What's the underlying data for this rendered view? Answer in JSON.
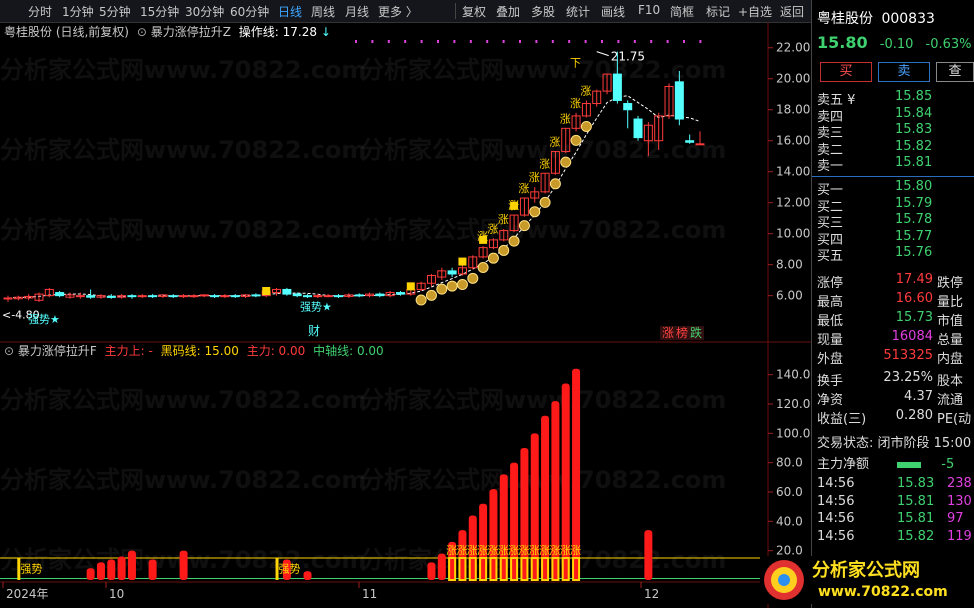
{
  "toolbar": {
    "periods": [
      "分时",
      "1分钟",
      "5分钟",
      "15分钟",
      "30分钟",
      "60分钟",
      "日线",
      "周线",
      "月线",
      "更多 〉"
    ],
    "active": "日线",
    "right": [
      "复权",
      "叠加",
      "多股",
      "统计",
      "画线",
      "F10",
      "简框",
      "标记",
      "+自选",
      "返回"
    ]
  },
  "info_bar": {
    "stock": "粤桂股份 (日线,前复权)",
    "indicator": "暴力涨停拉升Z",
    "line_label": "操作线: 17.28",
    "arrow": "↓"
  },
  "chart_data": {
    "type": "candlestick",
    "price_axis": [
      "22.00",
      "20.00",
      "18.00",
      "16.00",
      "14.00",
      "12.00",
      "10.00",
      "8.00",
      "6.00"
    ],
    "ylim": [
      4.3,
      22.5
    ],
    "annotations": {
      "high": "21.75",
      "low": "4.80",
      "strong": "强势★",
      "cai": "财",
      "zhangting": "涨",
      "bang": "榜",
      "die": "跌",
      "zhang": "涨",
      "xia": "下"
    },
    "candles": [
      {
        "o": 5.8,
        "c": 5.85,
        "h": 6.0,
        "l": 5.6
      },
      {
        "o": 5.8,
        "c": 5.9,
        "h": 6.0,
        "l": 5.7
      },
      {
        "o": 5.85,
        "c": 5.95,
        "h": 6.1,
        "l": 5.7
      },
      {
        "o": 5.7,
        "c": 6.1,
        "h": 6.2,
        "l": 5.6
      },
      {
        "o": 6.0,
        "c": 6.4,
        "h": 6.5,
        "l": 5.9
      },
      {
        "o": 6.2,
        "c": 6.0,
        "h": 6.3,
        "l": 5.9
      },
      {
        "o": 5.9,
        "c": 6.05,
        "h": 6.2,
        "l": 5.8
      },
      {
        "o": 5.95,
        "c": 6.0,
        "h": 6.2,
        "l": 5.8
      },
      {
        "o": 6.0,
        "c": 5.9,
        "h": 6.4,
        "l": 5.8
      },
      {
        "o": 5.9,
        "c": 6.0,
        "h": 6.1,
        "l": 5.8
      },
      {
        "o": 5.95,
        "c": 5.9,
        "h": 6.1,
        "l": 5.8
      },
      {
        "o": 5.9,
        "c": 6.0,
        "h": 6.1,
        "l": 5.8
      },
      {
        "o": 6.0,
        "c": 5.95,
        "h": 6.1,
        "l": 5.8
      },
      {
        "o": 5.95,
        "c": 6.0,
        "h": 6.1,
        "l": 5.85
      },
      {
        "o": 6.0,
        "c": 5.95,
        "h": 6.1,
        "l": 5.85
      },
      {
        "o": 5.95,
        "c": 6.05,
        "h": 6.1,
        "l": 5.85
      },
      {
        "o": 6.0,
        "c": 5.95,
        "h": 6.1,
        "l": 5.85
      },
      {
        "o": 5.95,
        "c": 6.0,
        "h": 6.1,
        "l": 5.85
      },
      {
        "o": 6.0,
        "c": 6.0,
        "h": 6.1,
        "l": 5.85
      },
      {
        "o": 6.0,
        "c": 6.05,
        "h": 6.1,
        "l": 5.9
      },
      {
        "o": 6.0,
        "c": 5.95,
        "h": 6.1,
        "l": 5.85
      },
      {
        "o": 5.95,
        "c": 6.0,
        "h": 6.1,
        "l": 5.85
      },
      {
        "o": 6.0,
        "c": 5.95,
        "h": 6.1,
        "l": 5.85
      },
      {
        "o": 5.95,
        "c": 6.05,
        "h": 6.1,
        "l": 5.85
      },
      {
        "o": 6.05,
        "c": 6.0,
        "h": 6.15,
        "l": 5.9
      },
      {
        "o": 6.0,
        "c": 6.3,
        "h": 6.4,
        "l": 5.9
      },
      {
        "o": 6.2,
        "c": 6.4,
        "h": 6.5,
        "l": 6.0
      },
      {
        "o": 6.4,
        "c": 6.1,
        "h": 6.5,
        "l": 6.0
      },
      {
        "o": 6.1,
        "c": 6.0,
        "h": 6.2,
        "l": 5.9
      },
      {
        "o": 6.0,
        "c": 5.95,
        "h": 6.1,
        "l": 5.85
      },
      {
        "o": 5.95,
        "c": 6.0,
        "h": 6.1,
        "l": 5.85
      },
      {
        "o": 6.0,
        "c": 6.0,
        "h": 6.1,
        "l": 5.9
      },
      {
        "o": 6.0,
        "c": 5.95,
        "h": 6.1,
        "l": 5.85
      },
      {
        "o": 5.95,
        "c": 6.05,
        "h": 6.15,
        "l": 5.85
      },
      {
        "o": 6.05,
        "c": 6.0,
        "h": 6.15,
        "l": 5.9
      },
      {
        "o": 6.0,
        "c": 6.1,
        "h": 6.2,
        "l": 5.9
      },
      {
        "o": 6.1,
        "c": 6.0,
        "h": 6.2,
        "l": 5.9
      },
      {
        "o": 6.0,
        "c": 6.2,
        "h": 6.3,
        "l": 5.9
      },
      {
        "o": 6.2,
        "c": 6.1,
        "h": 6.3,
        "l": 6.0
      },
      {
        "o": 6.1,
        "c": 6.4,
        "h": 6.5,
        "l": 6.0
      },
      {
        "o": 6.4,
        "c": 6.8,
        "h": 6.9,
        "l": 6.3
      },
      {
        "o": 6.8,
        "c": 7.3,
        "h": 7.4,
        "l": 6.6
      },
      {
        "o": 7.2,
        "c": 7.6,
        "h": 7.8,
        "l": 7.0
      },
      {
        "o": 7.6,
        "c": 7.4,
        "h": 7.8,
        "l": 7.2
      },
      {
        "o": 7.4,
        "c": 7.8,
        "h": 8.0,
        "l": 7.3
      },
      {
        "o": 7.8,
        "c": 8.5,
        "h": 8.6,
        "l": 7.7
      },
      {
        "o": 8.5,
        "c": 9.1,
        "h": 9.2,
        "l": 8.4
      },
      {
        "o": 9.1,
        "c": 9.6,
        "h": 9.7,
        "l": 9.0
      },
      {
        "o": 9.6,
        "c": 10.2,
        "h": 10.3,
        "l": 9.5
      },
      {
        "o": 10.2,
        "c": 11.2,
        "h": 11.2,
        "l": 10.1
      },
      {
        "o": 11.2,
        "c": 12.3,
        "h": 12.3,
        "l": 11.1
      },
      {
        "o": 12.3,
        "c": 12.7,
        "h": 13.0,
        "l": 12.0
      },
      {
        "o": 12.7,
        "c": 13.9,
        "h": 13.9,
        "l": 12.6
      },
      {
        "o": 13.9,
        "c": 15.3,
        "h": 15.3,
        "l": 13.8
      },
      {
        "o": 15.3,
        "c": 16.8,
        "h": 16.8,
        "l": 15.2
      },
      {
        "o": 16.8,
        "c": 17.6,
        "h": 17.8,
        "l": 16.6
      },
      {
        "o": 17.6,
        "c": 18.4,
        "h": 18.6,
        "l": 17.5
      },
      {
        "o": 18.4,
        "c": 19.2,
        "h": 19.3,
        "l": 18.2
      },
      {
        "o": 19.2,
        "c": 20.3,
        "h": 20.3,
        "l": 19.0
      },
      {
        "o": 20.3,
        "c": 18.6,
        "h": 21.75,
        "l": 18.4
      },
      {
        "o": 18.4,
        "c": 18.0,
        "h": 18.6,
        "l": 16.8
      },
      {
        "o": 17.4,
        "c": 16.2,
        "h": 17.6,
        "l": 16.0
      },
      {
        "o": 16.0,
        "c": 17.0,
        "h": 17.2,
        "l": 15.0
      },
      {
        "o": 16.0,
        "c": 17.6,
        "h": 17.8,
        "l": 15.4
      },
      {
        "o": 17.6,
        "c": 19.5,
        "h": 19.7,
        "l": 17.4
      },
      {
        "o": 19.8,
        "c": 17.4,
        "h": 20.5,
        "l": 17.0
      },
      {
        "o": 16.0,
        "c": 15.9,
        "h": 16.4,
        "l": 15.8
      },
      {
        "o": 15.8,
        "c": 15.8,
        "h": 16.6,
        "l": 15.73
      }
    ],
    "sub": {
      "ylabels": [
        "140.0",
        "120.0",
        "100.0",
        "80.0",
        "60.0",
        "40.0",
        "20.0"
      ],
      "ylim": [
        0,
        150
      ],
      "line_yellow": 15,
      "bars": [
        {
          "x": 8,
          "v": 8
        },
        {
          "x": 9,
          "v": 12
        },
        {
          "x": 10,
          "v": 14
        },
        {
          "x": 11,
          "v": 16
        },
        {
          "x": 12,
          "v": 20
        },
        {
          "x": 14,
          "v": 14
        },
        {
          "x": 17,
          "v": 20
        },
        {
          "x": 27,
          "v": 14
        },
        {
          "x": 29,
          "v": 6
        },
        {
          "x": 41,
          "v": 12
        },
        {
          "x": 42,
          "v": 18
        },
        {
          "x": 43,
          "v": 26
        },
        {
          "x": 44,
          "v": 34
        },
        {
          "x": 45,
          "v": 44
        },
        {
          "x": 46,
          "v": 52
        },
        {
          "x": 47,
          "v": 62
        },
        {
          "x": 48,
          "v": 72
        },
        {
          "x": 49,
          "v": 80
        },
        {
          "x": 50,
          "v": 90
        },
        {
          "x": 51,
          "v": 100
        },
        {
          "x": 52,
          "v": 112
        },
        {
          "x": 53,
          "v": 122
        },
        {
          "x": 54,
          "v": 134
        },
        {
          "x": 55,
          "v": 144
        },
        {
          "x": 62,
          "v": 34
        }
      ],
      "signal_bars": [
        43,
        44,
        45,
        46,
        47,
        48,
        49,
        50,
        51,
        52,
        53,
        54,
        55
      ],
      "strong_labels": [
        "强势",
        "强势"
      ]
    },
    "dates": [
      "2024年",
      "10",
      "11",
      "12"
    ]
  },
  "sub_bar": {
    "title": "暴力涨停拉升F",
    "l1": "主力上: -",
    "l2": "黑码线: 15.00",
    "l3": "主力: 0.00",
    "l4": "中轴线: 0.00"
  },
  "right": {
    "name": "粤桂股份",
    "code": "000833",
    "price": "15.80",
    "chg": "-0.10",
    "pct": "-0.63%",
    "buy_btn": "买",
    "sell_btn": "卖",
    "other_btn": "查",
    "sells": [
      {
        "label": "卖五 ¥",
        "price": "15.85"
      },
      {
        "label": "卖四",
        "price": "15.84"
      },
      {
        "label": "卖三",
        "price": "15.83"
      },
      {
        "label": "卖二",
        "price": "15.82"
      },
      {
        "label": "卖一",
        "price": "15.81"
      }
    ],
    "buys": [
      {
        "label": "买一",
        "price": "15.80"
      },
      {
        "label": "买二",
        "price": "15.79"
      },
      {
        "label": "买三",
        "price": "15.78"
      },
      {
        "label": "买四",
        "price": "15.77"
      },
      {
        "label": "买五",
        "price": "15.76"
      }
    ],
    "stats": [
      {
        "k": "涨停",
        "v": "17.49",
        "k2": "跌停"
      },
      {
        "k": "最高",
        "v": "16.60",
        "k2": "量比"
      },
      {
        "k": "最低",
        "v": "15.73",
        "k2": "市值"
      },
      {
        "k": "现量",
        "v": "16084",
        "k2": "总量"
      },
      {
        "k": "外盘",
        "v": "513325",
        "k2": "内盘"
      }
    ],
    "stats2": [
      {
        "k": "换手",
        "v": "23.25%",
        "k2": "股本"
      },
      {
        "k": "净资",
        "v": "4.37",
        "k2": "流通"
      },
      {
        "k": "收益(三)",
        "v": "0.280",
        "k2": "PE(动"
      }
    ],
    "trade_state": "交易状态: 闭市阶段 15:00",
    "net": "主力净额",
    "net_val": "-5",
    "ticks": [
      {
        "t": "14:56",
        "p": "15.83",
        "v": "238"
      },
      {
        "t": "14:56",
        "p": "15.81",
        "v": "130"
      },
      {
        "t": "14:56",
        "p": "15.81",
        "v": "97"
      },
      {
        "t": "14:56",
        "p": "15.82",
        "v": "119"
      }
    ]
  },
  "watermark": "分析家公式网www.70822.com",
  "logo": {
    "text": "分析家公式网",
    "url": "www.70822.com"
  },
  "colors": {
    "up": "#ff3b3b",
    "down": "#54ffff",
    "green": "#3fd16f",
    "yellow": "#ffd400",
    "accent": "#3ea7ff",
    "magenta": "#e040e0"
  }
}
